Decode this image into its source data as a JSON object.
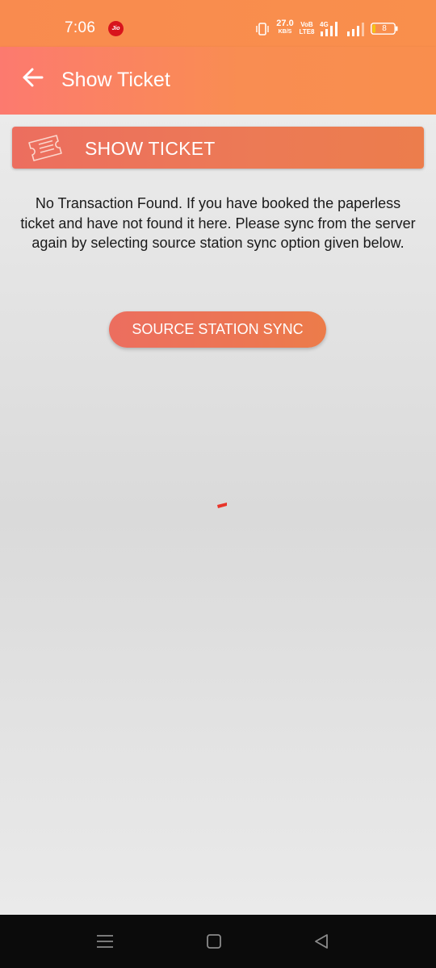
{
  "status_bar": {
    "time": "7:06",
    "carrier_badge": "Jio",
    "net_speed_value": "27.0",
    "net_speed_unit": "KB/S",
    "volte_top": "VoB",
    "volte_bottom": "LTE8",
    "network_type": "4G",
    "battery_level": "8"
  },
  "app_bar": {
    "title": "Show Ticket"
  },
  "section_header": {
    "title": "SHOW TICKET"
  },
  "message": "No Transaction Found. If you have booked the paperless ticket and have not found it here. Please sync from the server again by selecting source station sync option given below.",
  "sync_button_label": "SOURCE STATION SYNC",
  "colors": {
    "status_bar": "#f98b4f",
    "app_bar_start": "#fc7a6f",
    "app_bar_end": "#f98e4d",
    "button_start": "#ec6e5f",
    "button_end": "#ec7c4a",
    "spinner": "#e8352a",
    "nav_bar": "#0b0b0b"
  },
  "icons": {
    "back": "arrow-left-icon",
    "ticket": "ticket-icon",
    "spinner": "loading-spinner",
    "nav_menu": "menu-icon",
    "nav_home": "square-home-icon",
    "nav_back": "triangle-back-icon"
  }
}
